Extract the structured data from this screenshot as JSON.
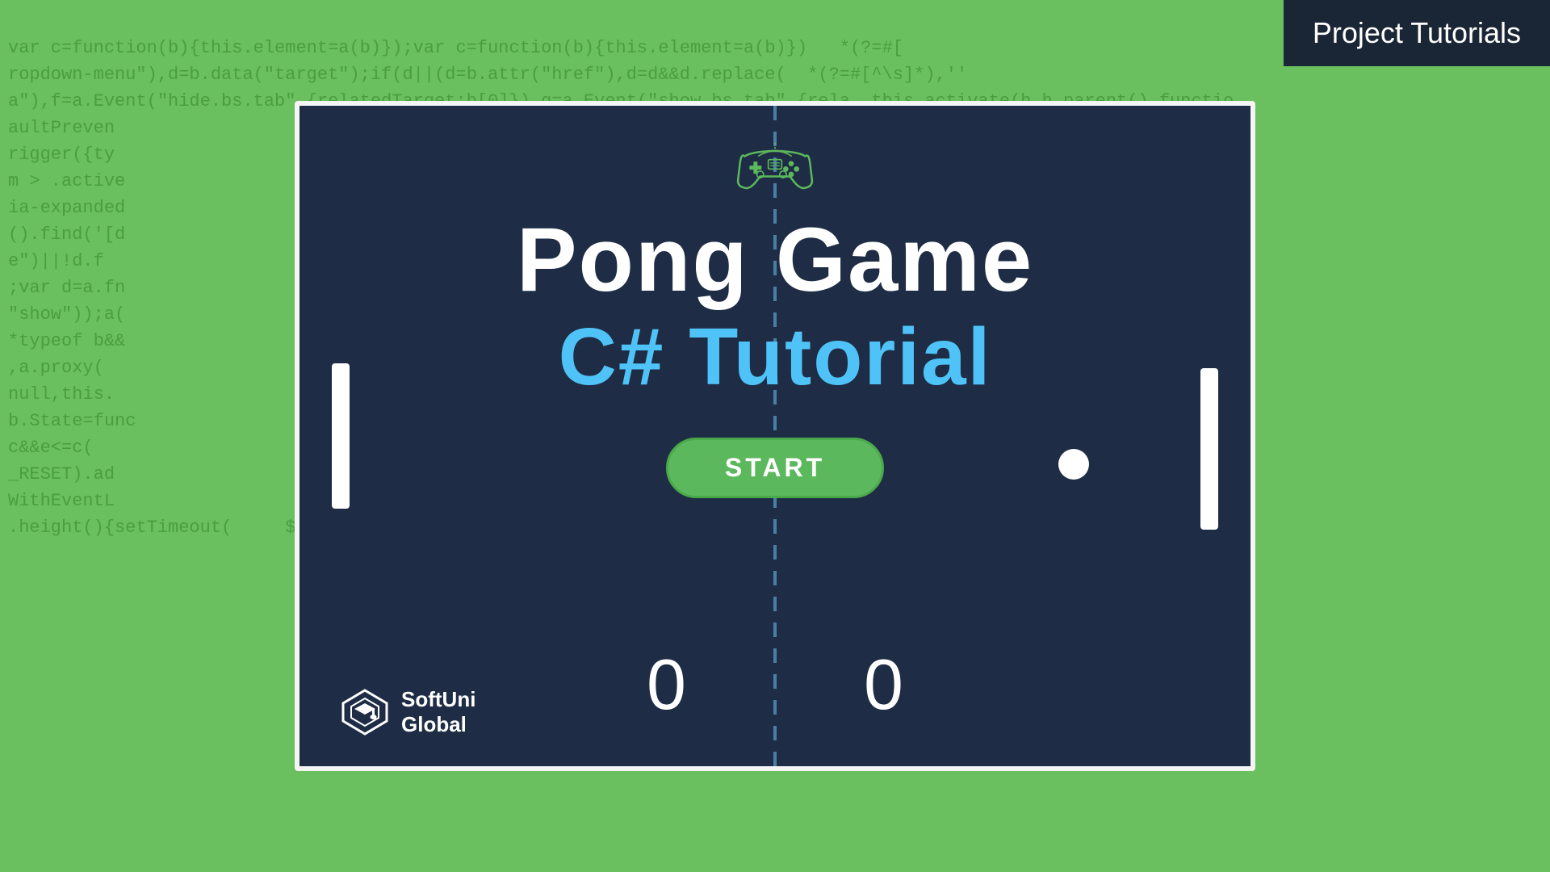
{
  "header": {
    "badge_label": "Project Tutorials"
  },
  "game": {
    "title": "Pong Game",
    "subtitle": "C# Tutorial",
    "start_button": "START",
    "score_left": "0",
    "score_right": "0"
  },
  "branding": {
    "name_line1": "SoftUni",
    "name_line2": "Global"
  },
  "code_background": "var c=function(b){this.element=a(b)});var c=function(b){this.element=a(b)}\nropdown-menu\"),d=b.data(\"target\");if(d||(d=b.attr(\"href\"),d=d&&d.replace( *(?=#[^\\s]*),''))\na\"),f=a.Event(\"hide.bs.tab\",{relatedTarget:b[0]}),g=a.Event(\"show.bs.tab\",{rela\naultPreven                                                                      {func\nrigger({ty                                                                      ,!1),\nm > .active                                                                     ropdo\nia-expanded                                                                     n=e&&\n().find('[d                                                                     \ne\")||!d.f                                                                      nEnd\n;var d=a.fn                                                                    a.fn.\n\"show\"));a(                                                                    .data\n*typeof b&&                                                                    f=\"ob\n,a.proxy(                                                                      get=a\nnull,this.                                                                     tionW\nb.State=func                                                                   x-top\nc&&e<=c(                                                                       \n_RESET).ad                                                                     $tar\nWithEventL                                                                     \n.height(){setTimeout(           $target.scrollTop(    h=function=func"
}
